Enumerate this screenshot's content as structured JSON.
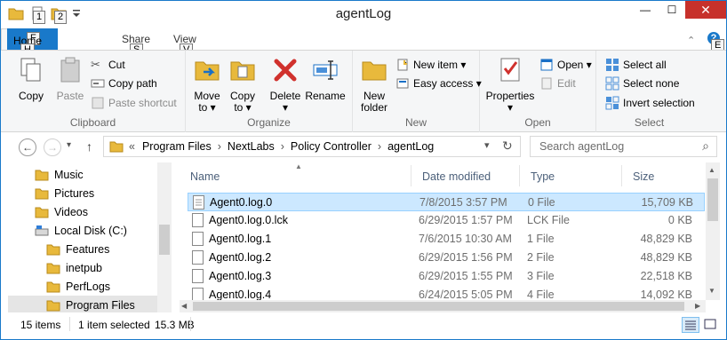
{
  "window": {
    "title": "agentLog",
    "minimize": "—",
    "maximize": "☐",
    "close": "✕"
  },
  "qat": {
    "keytip1": "1",
    "keytip2": "2"
  },
  "tabs": {
    "file": "F",
    "home": "Home",
    "home_keytip": "H",
    "share": "Share",
    "share_keytip": "S",
    "view": "View",
    "view_keytip": "V",
    "expand": "⌃",
    "help": "?",
    "help_keytip": "E"
  },
  "ribbon": {
    "clipboard": {
      "label": "Clipboard",
      "copy": "Copy",
      "paste": "Paste",
      "cut": "Cut",
      "copy_path": "Copy path",
      "paste_shortcut": "Paste shortcut"
    },
    "organize": {
      "label": "Organize",
      "move_to_1": "Move",
      "move_to_2": "to ▾",
      "copy_to_1": "Copy",
      "copy_to_2": "to ▾",
      "delete": "Delete",
      "delete_arrow": "▾",
      "rename": "Rename"
    },
    "new": {
      "label": "New",
      "new_folder_1": "New",
      "new_folder_2": "folder",
      "new_item": "New item ▾",
      "easy_access": "Easy access ▾"
    },
    "open": {
      "label": "Open",
      "properties": "Properties",
      "properties_arrow": "▾",
      "open": "Open ▾",
      "edit": "Edit"
    },
    "select": {
      "label": "Select",
      "select_all": "Select all",
      "select_none": "Select none",
      "invert": "Invert selection"
    }
  },
  "nav": {
    "back": "←",
    "forward": "→",
    "history": "▾",
    "up": "↑",
    "breadcrumb": [
      "«",
      "Program Files",
      "NextLabs",
      "Policy Controller",
      "agentLog"
    ],
    "sep": "›",
    "addr_dropdown": "▾",
    "refresh": "↻",
    "search_placeholder": "Search agentLog",
    "search_icon": "⌕"
  },
  "tree": [
    {
      "label": "Music"
    },
    {
      "label": "Pictures"
    },
    {
      "label": "Videos"
    },
    {
      "label": "Local Disk (C:)"
    },
    {
      "label": "Features"
    },
    {
      "label": "inetpub"
    },
    {
      "label": "PerfLogs"
    },
    {
      "label": "Program Files"
    }
  ],
  "columns": {
    "name": "Name",
    "date": "Date modified",
    "type": "Type",
    "size": "Size"
  },
  "files": [
    {
      "name": "Agent0.log.0",
      "date": "7/8/2015 3:57 PM",
      "type": "0 File",
      "size": "15,709 KB",
      "selected": true
    },
    {
      "name": "Agent0.log.0.lck",
      "date": "6/29/2015 1:57 PM",
      "type": "LCK File",
      "size": "0 KB"
    },
    {
      "name": "Agent0.log.1",
      "date": "7/6/2015 10:30 AM",
      "type": "1 File",
      "size": "48,829 KB"
    },
    {
      "name": "Agent0.log.2",
      "date": "6/29/2015 1:56 PM",
      "type": "2 File",
      "size": "48,829 KB"
    },
    {
      "name": "Agent0.log.3",
      "date": "6/29/2015 1:55 PM",
      "type": "3 File",
      "size": "22,518 KB"
    },
    {
      "name": "Agent0.log.4",
      "date": "6/24/2015 5:05 PM",
      "type": "4 File",
      "size": "14,092 KB"
    }
  ],
  "status": {
    "items": "15 items",
    "selected": "1 item selected",
    "size": "15.3 MB"
  },
  "colors": {
    "accent": "#1979ca",
    "selection": "#cce8ff",
    "folder": "#e8b93c",
    "close": "#c7312b"
  }
}
